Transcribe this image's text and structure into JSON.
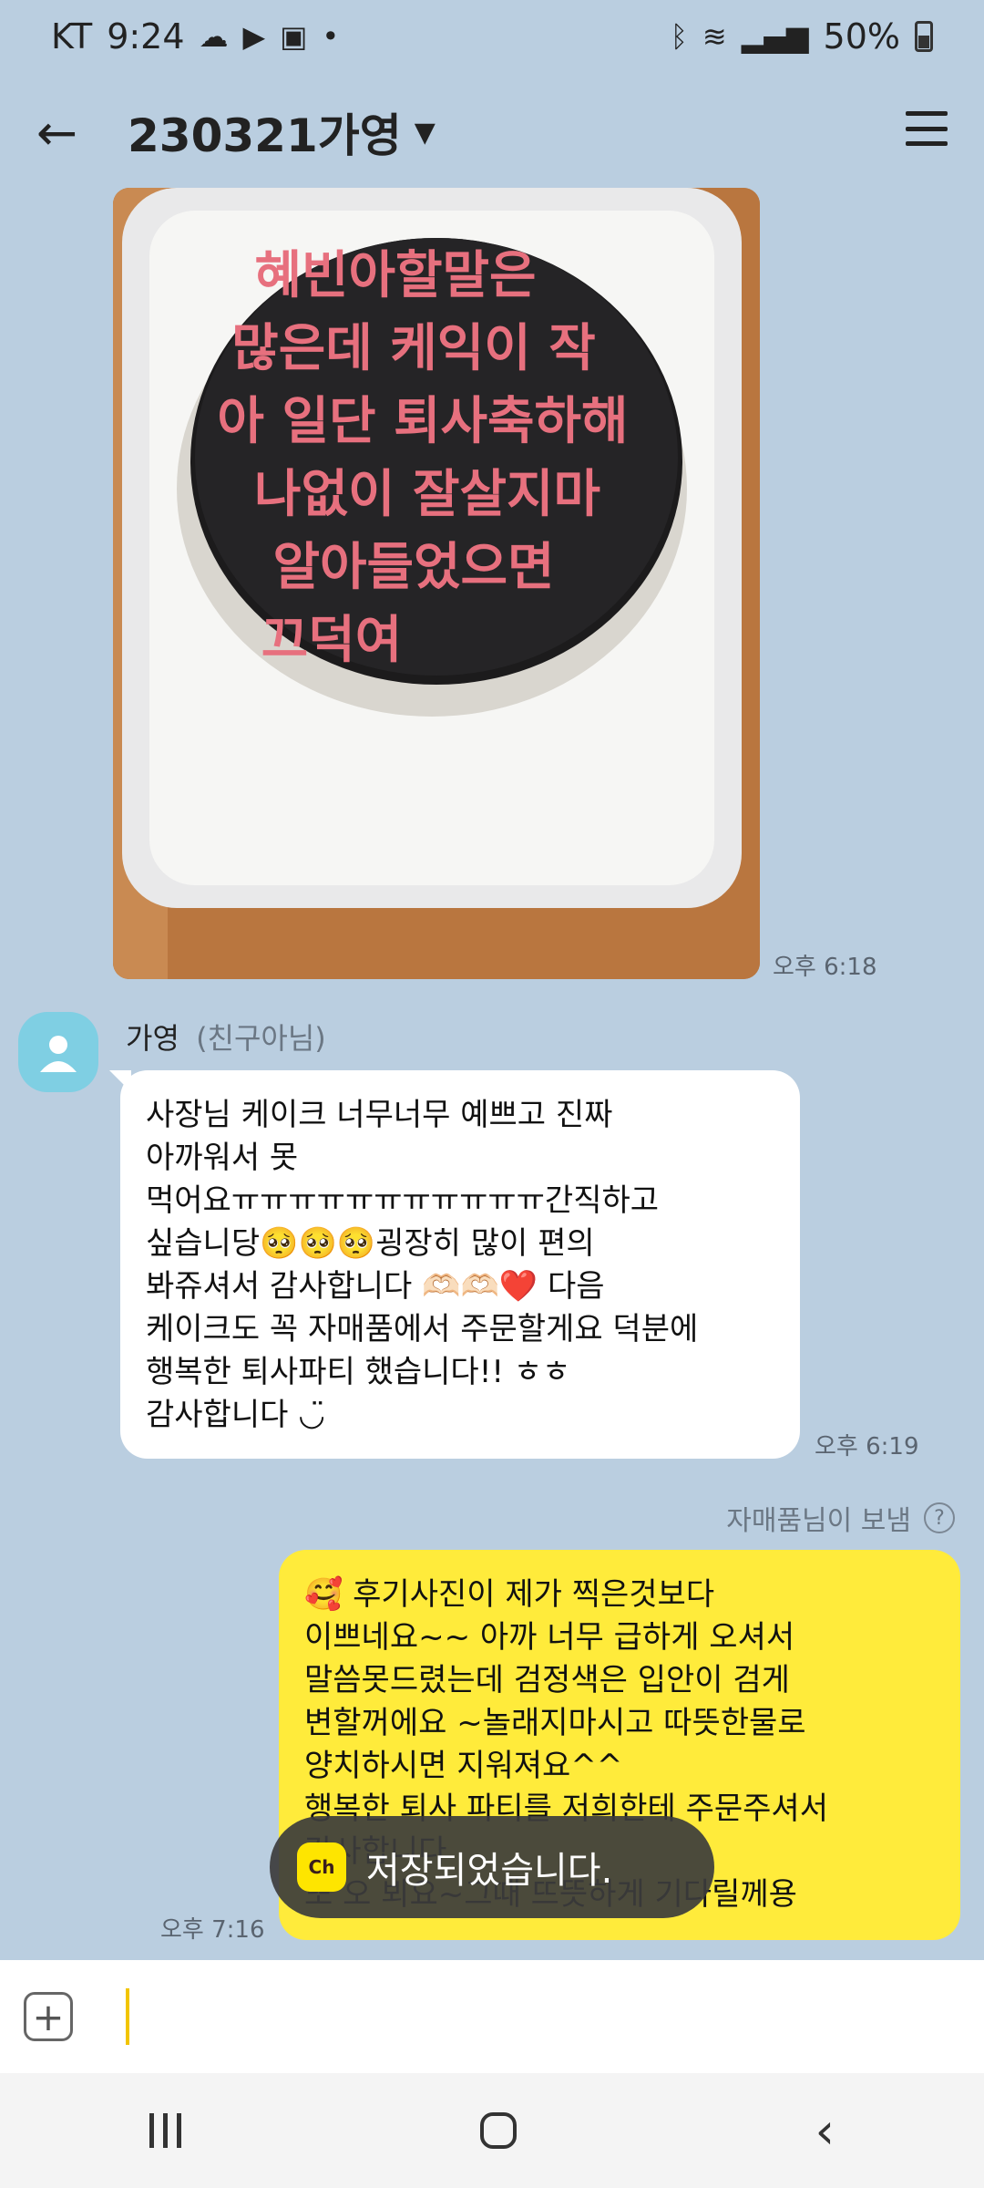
{
  "status_bar": {
    "carrier": "KT",
    "time": "9:24",
    "battery": "50%"
  },
  "header": {
    "title": "230321가영"
  },
  "messages": {
    "photo_time": "오후 6:18",
    "friend": {
      "name": "가영",
      "badge": "(친구아님)",
      "lines": [
        "사장님 케이크 너무너무 예쁘고 진짜",
        "아까워서 못",
        "먹어요ㅠㅠㅠㅠㅠㅠㅠㅠㅠㅠㅠ간직하고",
        "싶습니당🥺🥺🥺굉장히 많이 편의",
        "봐쥬셔서 감사합니다 🫶🏻🫶🏻❤️ 다음",
        "케이크도 꼭 자매품에서 주문할게요 덕분에",
        "행복한 퇴사파티 했습니다!! ㅎㅎ",
        "감사합니다 ◡̈"
      ],
      "time": "오후 6:19"
    },
    "sent_via": "자매품님이 보냄",
    "reply": {
      "lines": [
        "🥰 후기사진이 제가 찍은것보다",
        "이쁘네요~~ 아까 너무 급하게 오셔서",
        "말씀못드렸는데 검정색은 입안이 검게",
        "변할꺼에요 ~놀래지마시고 따뜻한물로",
        "양치하시면 지워져요^^",
        "행복한 퇴사 파티를 저희한테 주문주셔서",
        "감사합니다",
        "또 오 뵈요~그때 뜨뜻하게 기다릴께용"
      ],
      "time": "오후 7:16"
    }
  },
  "photo": {
    "cake_text": [
      "혜빈아할말은",
      "많은데 케익이 작",
      "아 일단 퇴사축하해",
      "나없이 잘살지마",
      "알아들었으면",
      "끄덕여"
    ]
  },
  "toast": {
    "logo": "Ch",
    "text": "저장되었습니다."
  }
}
